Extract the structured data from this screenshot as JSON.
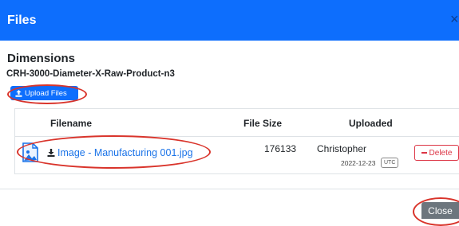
{
  "modal": {
    "title": "Files",
    "close_x": "×"
  },
  "section": {
    "title": "Dimensions",
    "product": "CRH-3000-Diameter-X-Raw-Product-n3"
  },
  "upload": {
    "label": "Upload Files"
  },
  "table": {
    "headers": [
      "Filename",
      "File Size",
      "Uploaded"
    ],
    "rows": [
      {
        "filename": "Image - Manufacturing 001.jpg",
        "size": "176133",
        "uploader": "Christopher",
        "date": "2022-12-23",
        "tz": "UTC",
        "delete_label": "Delete"
      }
    ]
  },
  "footer": {
    "close_label": "Close"
  },
  "colors": {
    "primary": "#0d6efd",
    "danger": "#dc3545",
    "secondary": "#6c757d",
    "annotation": "#d9342b"
  }
}
